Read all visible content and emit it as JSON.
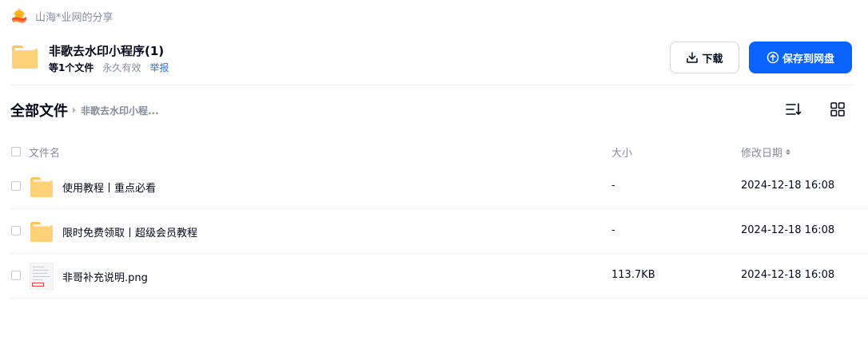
{
  "sharer": {
    "name": "山海*业网的分享"
  },
  "share": {
    "title": "非歌去水印小程序(1)",
    "file_count": "等1个文件",
    "expiry": "永久有效",
    "report": "举报"
  },
  "actions": {
    "download": "下载",
    "save": "保存到网盘"
  },
  "breadcrumb": {
    "root": "全部文件",
    "current": "非歌去水印小程..."
  },
  "columns": {
    "name": "文件名",
    "size": "大小",
    "date": "修改日期"
  },
  "files": [
    {
      "name": "使用教程丨重点必看",
      "type": "folder",
      "size": "-",
      "date": "2024-12-18 16:08"
    },
    {
      "name": "限时免费领取丨超级会员教程",
      "type": "folder",
      "size": "-",
      "date": "2024-12-18 16:08"
    },
    {
      "name": "非哥补充说明.png",
      "type": "image",
      "size": "113.7KB",
      "date": "2024-12-18 16:08"
    }
  ],
  "colors": {
    "primary": "#0b63ff",
    "link": "#2a72f8",
    "folder": "#ffc35c",
    "muted": "#878c9c"
  },
  "icons": {
    "avatar": "sunset-avatar-icon",
    "folder": "folder-icon",
    "download": "download-icon",
    "save": "cloud-upload-icon",
    "sort": "sort-list-icon",
    "grid": "grid-view-icon"
  }
}
